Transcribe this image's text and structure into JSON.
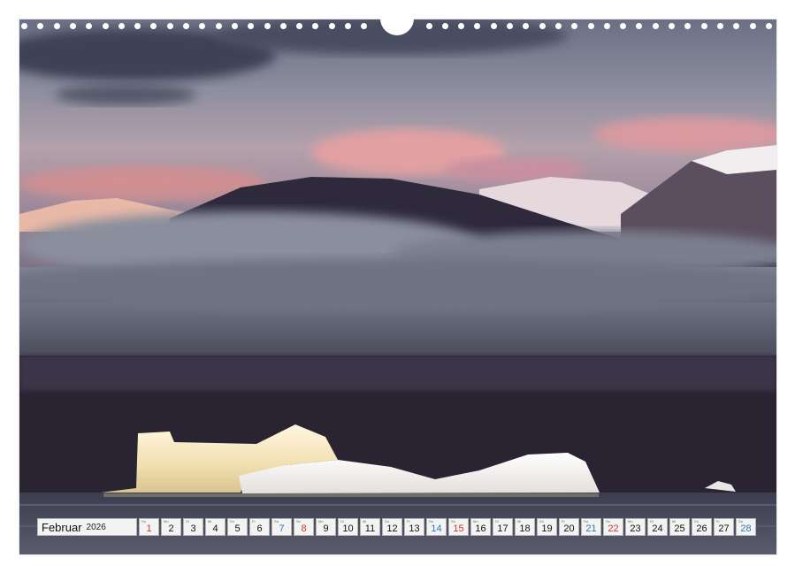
{
  "calendar": {
    "month": "Februar",
    "year": "2026",
    "days": [
      {
        "n": "1",
        "wd": "So",
        "type": "sun"
      },
      {
        "n": "2",
        "wd": "Mo",
        "type": "weekday"
      },
      {
        "n": "3",
        "wd": "Di",
        "type": "weekday"
      },
      {
        "n": "4",
        "wd": "Mi",
        "type": "weekday"
      },
      {
        "n": "5",
        "wd": "Do",
        "type": "weekday"
      },
      {
        "n": "6",
        "wd": "Fr",
        "type": "weekday"
      },
      {
        "n": "7",
        "wd": "Sa",
        "type": "sat"
      },
      {
        "n": "8",
        "wd": "So",
        "type": "sun"
      },
      {
        "n": "9",
        "wd": "Mo",
        "type": "weekday"
      },
      {
        "n": "10",
        "wd": "Di",
        "type": "weekday"
      },
      {
        "n": "11",
        "wd": "Mi",
        "type": "weekday"
      },
      {
        "n": "12",
        "wd": "Do",
        "type": "weekday"
      },
      {
        "n": "13",
        "wd": "Fr",
        "type": "weekday"
      },
      {
        "n": "14",
        "wd": "Sa",
        "type": "sat"
      },
      {
        "n": "15",
        "wd": "So",
        "type": "sun"
      },
      {
        "n": "16",
        "wd": "Mo",
        "type": "weekday"
      },
      {
        "n": "17",
        "wd": "Di",
        "type": "weekday"
      },
      {
        "n": "18",
        "wd": "Mi",
        "type": "weekday"
      },
      {
        "n": "19",
        "wd": "Do",
        "type": "weekday"
      },
      {
        "n": "20",
        "wd": "Fr",
        "type": "weekday"
      },
      {
        "n": "21",
        "wd": "Sa",
        "type": "sat"
      },
      {
        "n": "22",
        "wd": "So",
        "type": "sun"
      },
      {
        "n": "23",
        "wd": "Mo",
        "type": "weekday"
      },
      {
        "n": "24",
        "wd": "Di",
        "type": "weekday"
      },
      {
        "n": "25",
        "wd": "Mi",
        "type": "weekday"
      },
      {
        "n": "26",
        "wd": "Do",
        "type": "weekday"
      },
      {
        "n": "27",
        "wd": "Fr",
        "type": "weekday"
      },
      {
        "n": "28",
        "wd": "Sa",
        "type": "sat"
      }
    ]
  },
  "colors": {
    "sunday": "#d0312d",
    "saturday": "#2a78b5",
    "cell_bg": "#f3f3f3"
  },
  "icons": {
    "binding_holes": "ring-binding-holes",
    "hanger": "hanger-notch"
  }
}
